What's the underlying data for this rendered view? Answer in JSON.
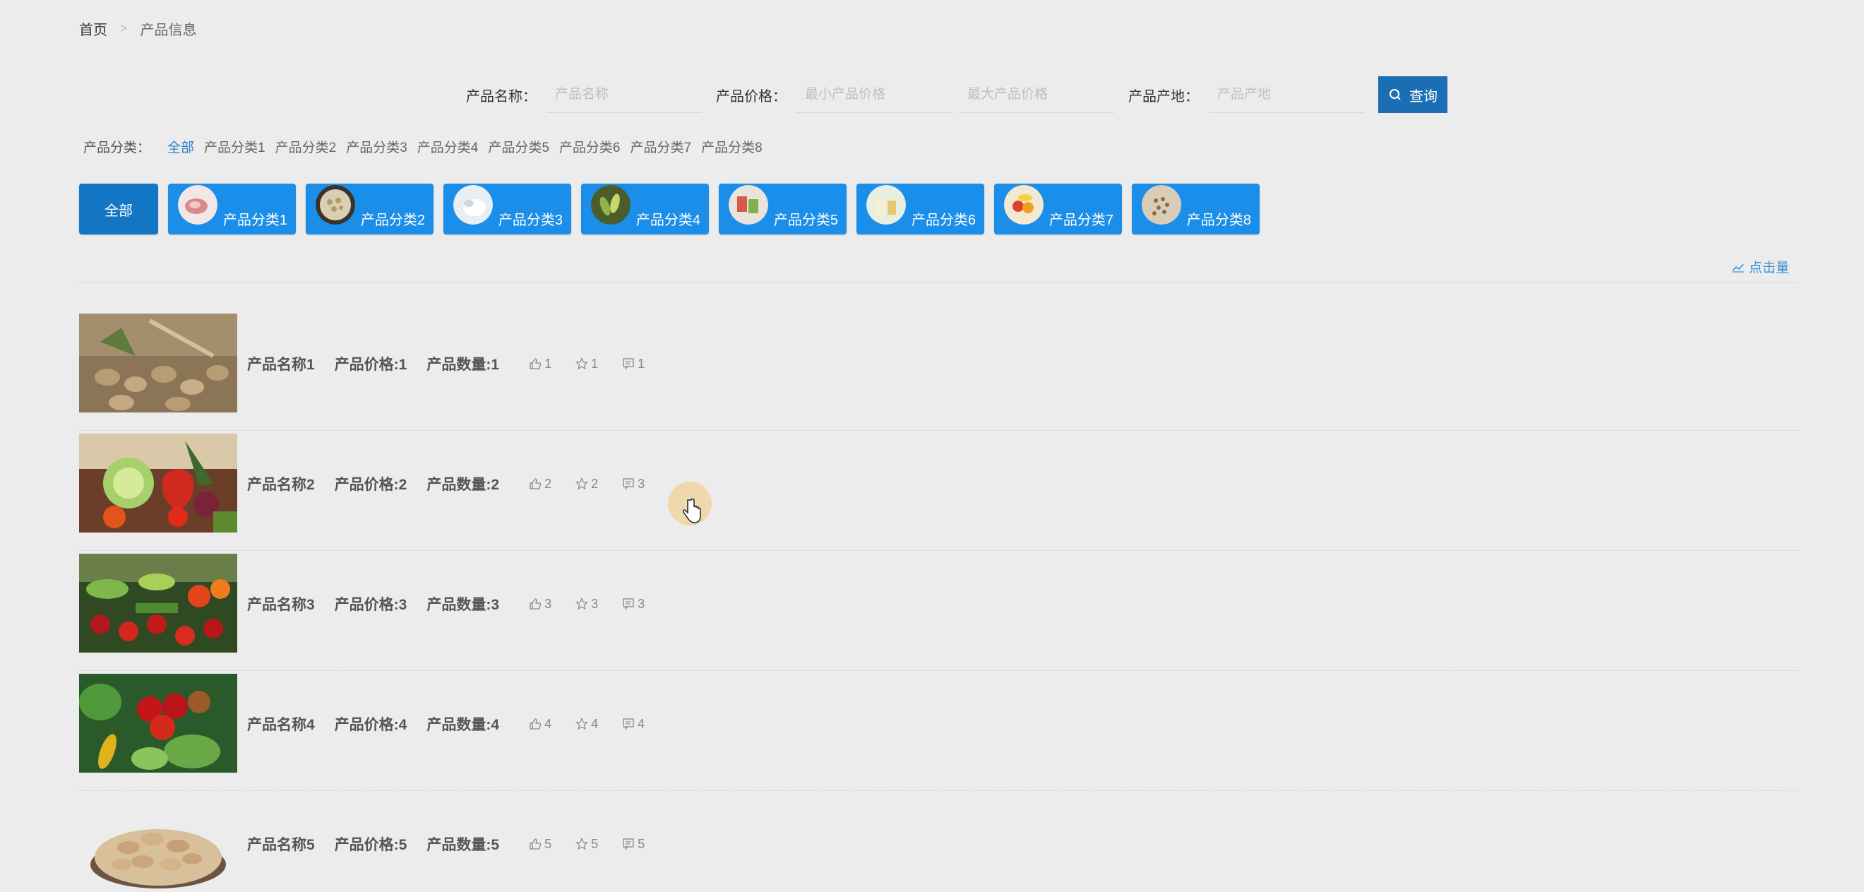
{
  "breadcrumb": {
    "home": "首页",
    "separator": ">",
    "current": "产品信息"
  },
  "search": {
    "name_label": "产品名称：",
    "name_placeholder": "产品名称",
    "price_label": "产品价格：",
    "min_price_placeholder": "最小产品价格",
    "max_price_placeholder": "最大产品价格",
    "origin_label": "产品产地：",
    "origin_placeholder": "产品产地",
    "query_label": "查询"
  },
  "category_links": {
    "label": "产品分类：",
    "items": [
      "全部",
      "产品分类1",
      "产品分类2",
      "产品分类3",
      "产品分类4",
      "产品分类5",
      "产品分类6",
      "产品分类7",
      "产品分类8"
    ]
  },
  "category_buttons": {
    "all_label": "全部",
    "items": [
      {
        "label": "产品分类1",
        "icon": "meat-thumb"
      },
      {
        "label": "产品分类2",
        "icon": "nuts-thumb"
      },
      {
        "label": "产品分类3",
        "icon": "rice-thumb"
      },
      {
        "label": "产品分类4",
        "icon": "vegetable-thumb"
      },
      {
        "label": "产品分类5",
        "icon": "snack-thumb"
      },
      {
        "label": "产品分类6",
        "icon": "dairy-thumb"
      },
      {
        "label": "产品分类7",
        "icon": "fruit-thumb"
      },
      {
        "label": "产品分类8",
        "icon": "grain-thumb"
      }
    ]
  },
  "sort": {
    "label": "点击量",
    "icon": "trend-icon"
  },
  "products": [
    {
      "name": "产品名称1",
      "price": "产品价格:1",
      "quantity": "产品数量:1",
      "likes": "1",
      "favorites": "1",
      "comments": "1",
      "image": "potatoes-image"
    },
    {
      "name": "产品名称2",
      "price": "产品价格:2",
      "quantity": "产品数量:2",
      "likes": "2",
      "favorites": "2",
      "comments": "3",
      "image": "vegetables-image"
    },
    {
      "name": "产品名称3",
      "price": "产品价格:3",
      "quantity": "产品数量:3",
      "likes": "3",
      "favorites": "3",
      "comments": "3",
      "image": "market-vegetables-image"
    },
    {
      "name": "产品名称4",
      "price": "产品价格:4",
      "quantity": "产品数量:4",
      "likes": "4",
      "favorites": "4",
      "comments": "4",
      "image": "apples-vegetables-image"
    },
    {
      "name": "产品名称5",
      "price": "产品价格:5",
      "quantity": "产品数量:5",
      "likes": "5",
      "favorites": "5",
      "comments": "5",
      "image": "peanuts-image"
    }
  ],
  "colors": {
    "primary": "#1a8ee8",
    "query_button": "#1b6eb3",
    "link_active": "#2d7fd0",
    "background": "#ececec"
  }
}
